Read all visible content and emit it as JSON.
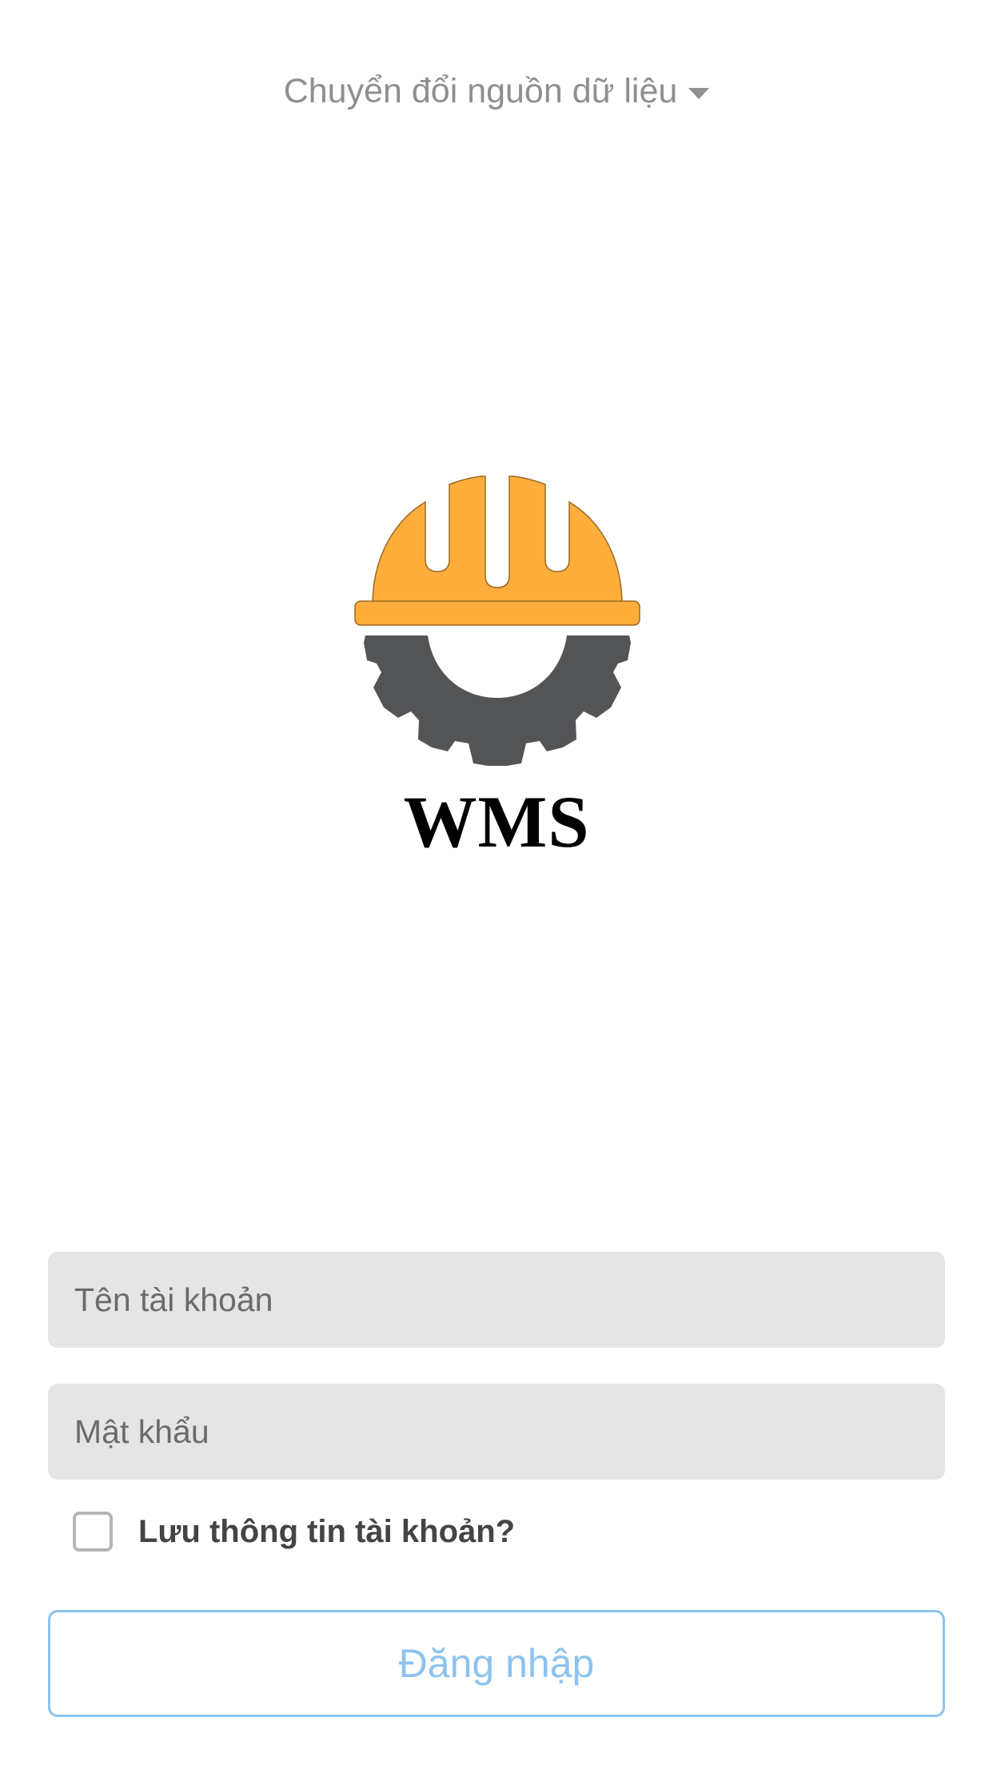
{
  "header": {
    "source_switch_label": "Chuyển đổi nguồn dữ liệu",
    "caret_icon": "caret-down-icon"
  },
  "logo": {
    "icon": "hard-hat-gear-icon",
    "app_name": "WMS",
    "helmet_color": "#ffae3b",
    "gear_color": "#535456"
  },
  "form": {
    "username_placeholder": "Tên tài khoản",
    "username_value": "",
    "password_placeholder": "Mật khẩu",
    "password_value": "",
    "remember_label": "Lưu thông tin tài khoản?",
    "remember_checked": false,
    "login_label": "Đăng nhập"
  },
  "colors": {
    "field_background": "#e5e5e5",
    "accent": "#8cc3f0",
    "muted_text": "#8e8e93"
  }
}
